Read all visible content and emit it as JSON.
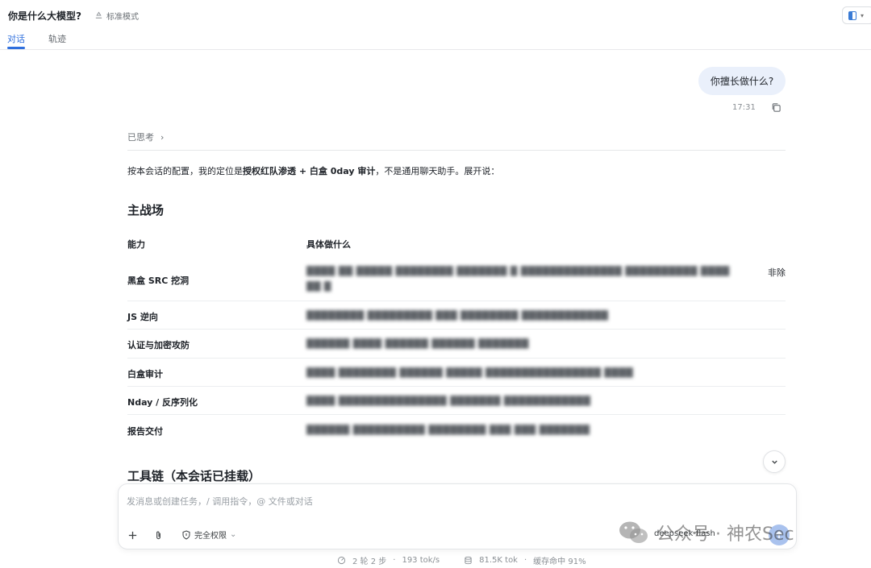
{
  "header": {
    "title": "你是什么大模型?",
    "mode_label": "标准模式",
    "tabs": [
      {
        "label": "对话",
        "active": true
      },
      {
        "label": "轨迹",
        "active": false
      }
    ],
    "accent_color": "#2f6fdd"
  },
  "conversation": {
    "user_message": "你擅长做什么?",
    "user_message_time": "17:31",
    "thought_label": "已思考",
    "intro_prefix": "按本会话的配置，我的定位是",
    "intro_bold": "授权红队渗透 + 白盒 0day 审计",
    "intro_suffix": "，不是通用聊天助手。展开说：",
    "section_main": "主战场",
    "table": {
      "headers": [
        "能力",
        "具体做什么"
      ],
      "rows": [
        {
          "label": "黑盒 SRC 挖洞",
          "detail": "████ ██ █████ ████████ ███████ █ ██████████████ ██████████ ████"
        },
        {
          "label": "JS 逆向",
          "detail": "████████ █████████ ███ ████████ ████████████"
        },
        {
          "label": "认证与加密攻防",
          "detail": "██████ ████ ██████ ██████ ███████"
        },
        {
          "label": "白盒审计",
          "detail": "████ ████████ ██████ █████ ████████████████ ████"
        },
        {
          "label": "Nday / 反序列化",
          "detail": "████ ███████████████ ███████ ████████████"
        },
        {
          "label": "报告交付",
          "detail": "██████ ██████████ ████████ ███ ███ ███████"
        }
      ],
      "row0_tail": "非除"
    },
    "section_tools": "工具链（本会话已挂载）"
  },
  "composer": {
    "placeholder": "发消息或创建任务，/ 调用指令，@ 文件或对话",
    "permission_label": "完全权限",
    "model_label": "deepseek-flash"
  },
  "status_bar": {
    "rounds": "2 轮 2 步",
    "speed": "193 tok/s",
    "tokens": "81.5K tok",
    "cache": "缓存命中 91%"
  },
  "watermark": {
    "text": "公众号 · 神农Sec"
  }
}
